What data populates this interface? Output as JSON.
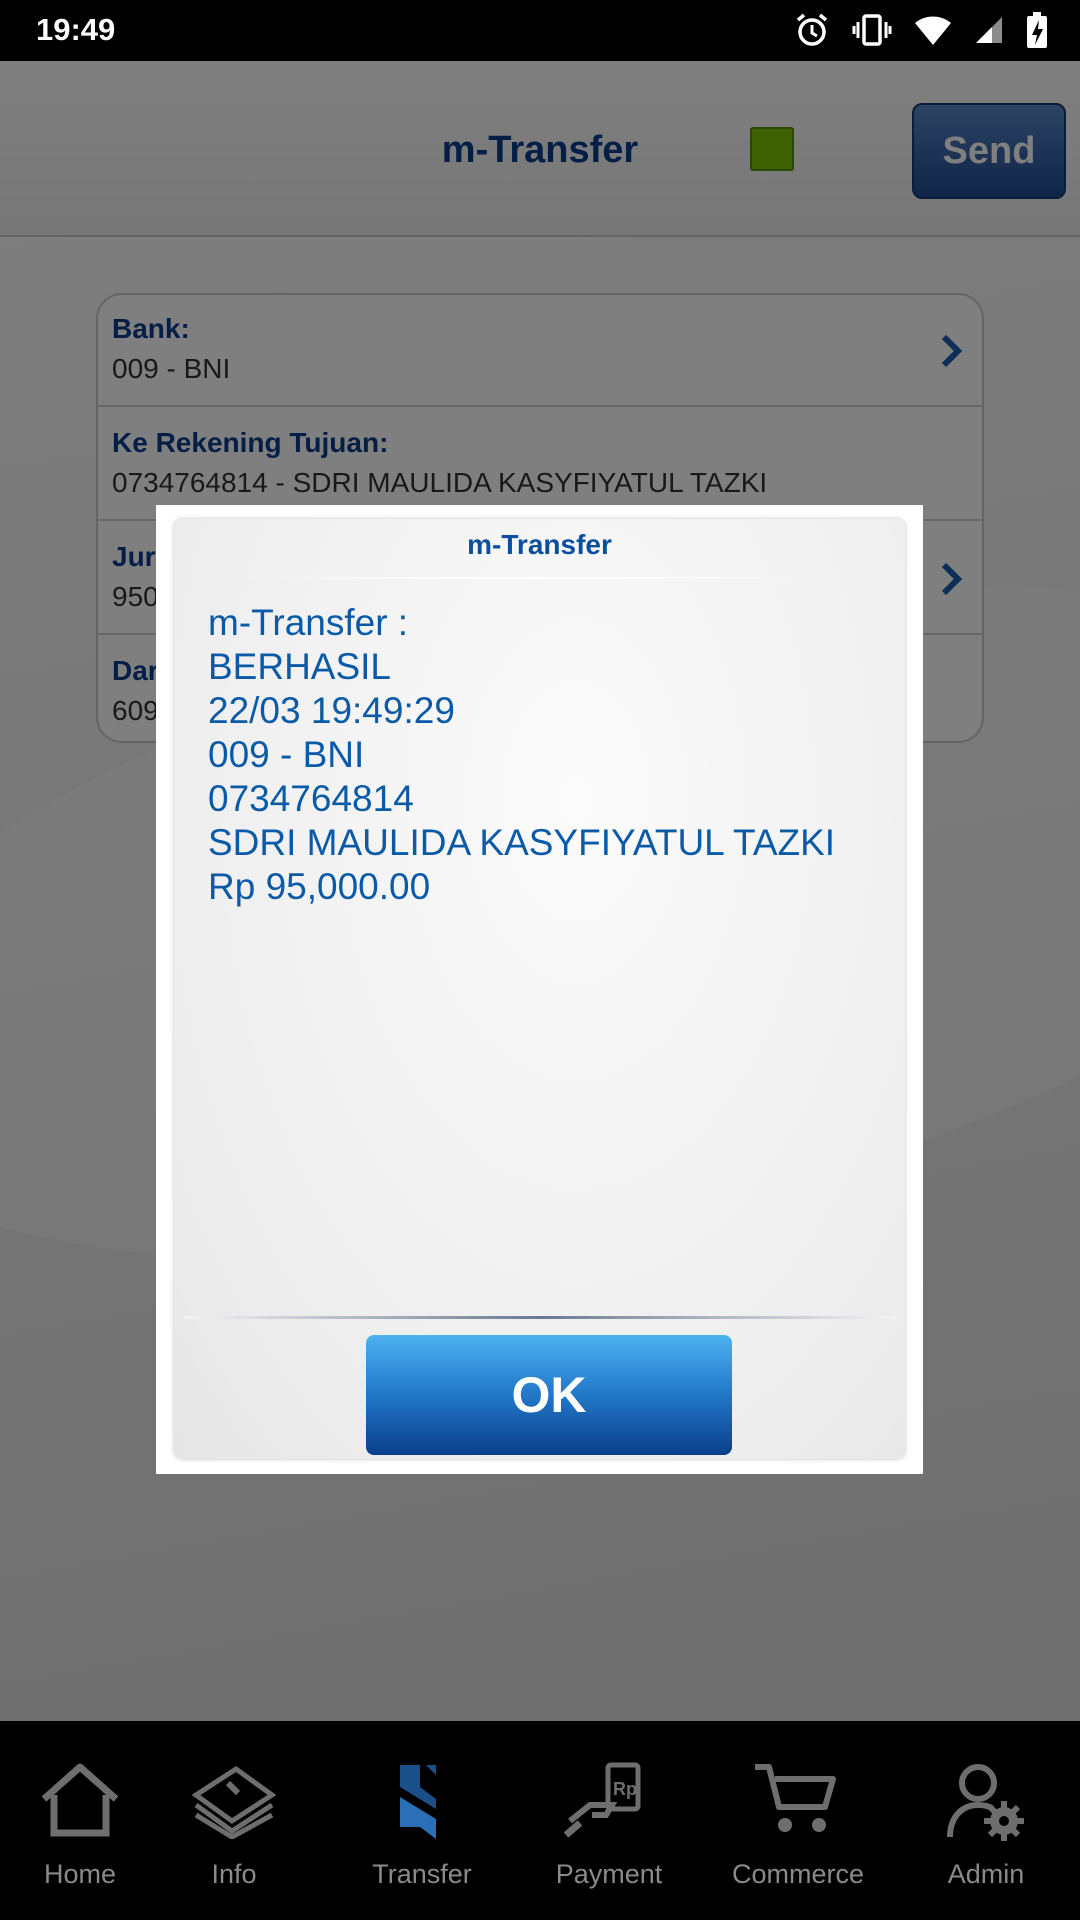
{
  "status_bar": {
    "time": "19:49"
  },
  "header": {
    "title": "m-Transfer",
    "send_label": "Send",
    "indicator_color": "#7cc000"
  },
  "form": {
    "rows": [
      {
        "label": "Bank:",
        "value": "009 - BNI",
        "has_chevron": true
      },
      {
        "label": "Ke Rekening Tujuan:",
        "value": "0734764814 - SDRI MAULIDA KASYFIYATUL TAZKI",
        "has_chevron": false
      },
      {
        "label": "Jur",
        "value": "950",
        "has_chevron": true
      },
      {
        "label": "Dar",
        "value": "609",
        "has_chevron": false
      }
    ]
  },
  "dialog": {
    "title": "m-Transfer",
    "message_lines": [
      "m-Transfer :",
      "BERHASIL",
      "22/03 19:49:29",
      "009 - BNI",
      "0734764814",
      "SDRI MAULIDA KASYFIYATUL TAZKI",
      "Rp 95,000.00"
    ],
    "ok_label": "OK"
  },
  "bottom_nav": {
    "items": [
      {
        "label": "Home",
        "icon": "home-icon"
      },
      {
        "label": "Info",
        "icon": "info-book-icon"
      },
      {
        "label": "Transfer",
        "icon": "transfer-icon"
      },
      {
        "label": "Payment",
        "icon": "payment-icon"
      },
      {
        "label": "Commerce",
        "icon": "cart-icon"
      },
      {
        "label": "Admin",
        "icon": "admin-gear-icon"
      }
    ]
  },
  "colors": {
    "accent_blue": "#0b3d8c",
    "dialog_text": "#0b5aa8"
  }
}
